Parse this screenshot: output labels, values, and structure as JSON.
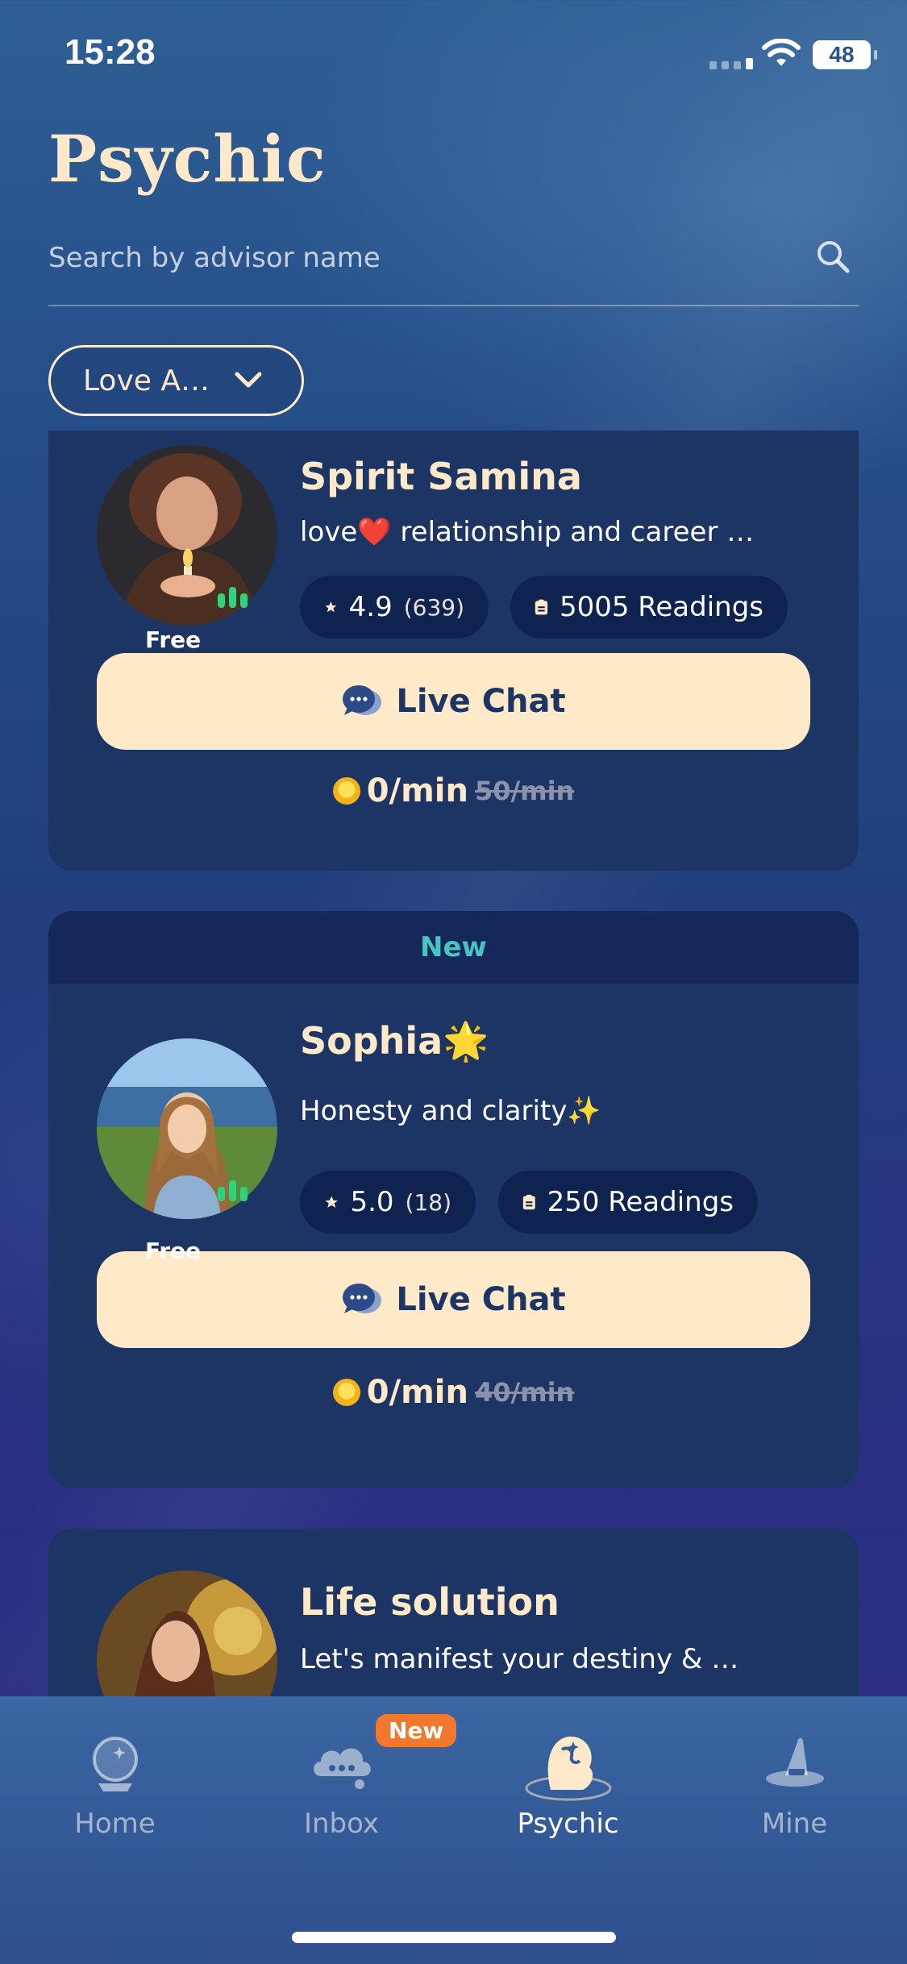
{
  "status_bar": {
    "time": "15:28",
    "battery": "48"
  },
  "header": {
    "title": "Psychic"
  },
  "search": {
    "placeholder": "Search by advisor name"
  },
  "filter": {
    "selected": "Love A…"
  },
  "advisors": [
    {
      "band": "",
      "name": "Spirit Samina",
      "description": "love❤️ relationship and career …",
      "rating": "4.9",
      "reviews": "(639)",
      "readings": "5005 Readings",
      "tag": "Free",
      "cta": "Live Chat",
      "price_now": "0/min",
      "price_old": "50/min"
    },
    {
      "band": "New",
      "name": "Sophia🌟",
      "description": "Honesty and clarity✨",
      "rating": "5.0",
      "reviews": "(18)",
      "readings": "250 Readings",
      "tag": "Free",
      "cta": "Live Chat",
      "price_now": "0/min",
      "price_old": "40/min"
    },
    {
      "band": "",
      "name": "Life solution",
      "description": "Let's manifest your destiny & …"
    }
  ],
  "tabbar": {
    "tabs": [
      {
        "label": "Home",
        "icon": "crystal-ball-icon",
        "active": false
      },
      {
        "label": "Inbox",
        "icon": "cloud-chat-icon",
        "active": false,
        "badge": "New"
      },
      {
        "label": "Psychic",
        "icon": "psychic-icon",
        "active": true
      },
      {
        "label": "Mine",
        "icon": "wizard-hat-icon",
        "active": false
      }
    ]
  },
  "colors": {
    "accent": "#ffe9c8",
    "card": "#1d3565",
    "new": "#49c4c0",
    "badge": "#f2782e",
    "online": "#35d07a"
  }
}
